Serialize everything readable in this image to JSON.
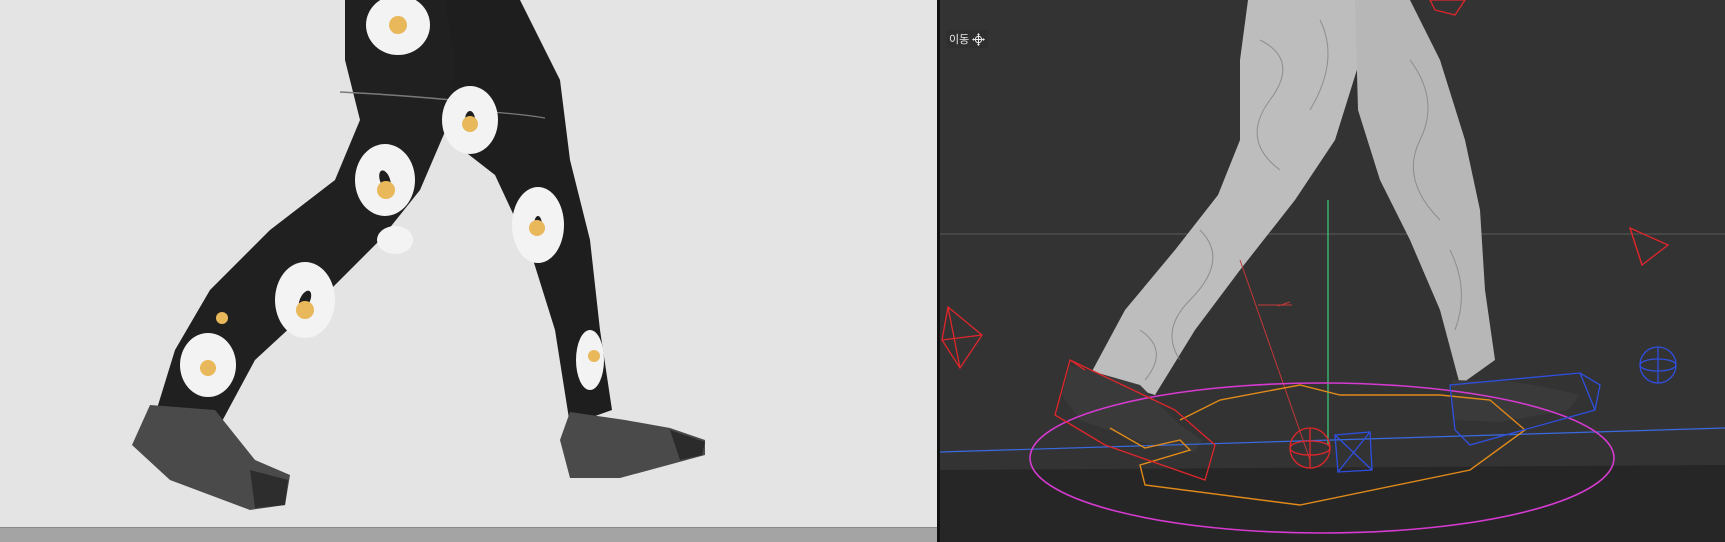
{
  "left_viewport": {
    "background": "#e4e4e4",
    "scrollbar_color": "#a4a4a4"
  },
  "right_viewport": {
    "background": "#333333",
    "tool": {
      "label": "이동",
      "icon": "move-icon"
    },
    "gizmo_colors": {
      "left_control": "#e0262b",
      "right_control": "#2f4fe0",
      "root_circle": "#d63ad0",
      "hip_path": "#e08a1a",
      "axis_y": "#3ad07a",
      "axis_x": "#3a6ae0"
    }
  }
}
